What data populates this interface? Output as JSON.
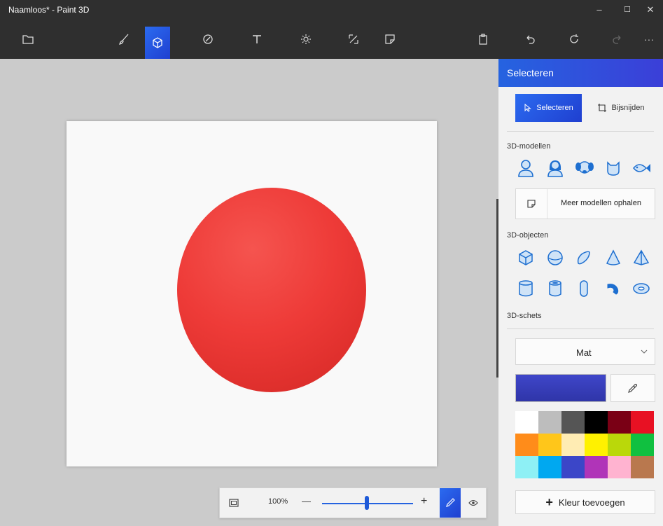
{
  "window": {
    "title": "Naamloos* - Paint 3D"
  },
  "window_controls": {
    "minimize": "–",
    "maximize": "☐",
    "close": "✕"
  },
  "toolbar": {
    "more_label": "···"
  },
  "zoom": {
    "value_text": "100%",
    "minus": "—",
    "plus": "+",
    "slider_level": 0.5
  },
  "panel": {
    "header": "Selecteren",
    "select_label": "Selecteren",
    "crop_label": "Bijsnijden",
    "section_models": "3D-modellen",
    "more_models_label": "Meer modellen ophalen",
    "section_objects": "3D-objecten",
    "section_sketch": "3D-schets",
    "material_dropdown": "Mat",
    "add_color_label": "Kleur toevoegen",
    "add_color_plus": "+",
    "current_color": "#3a3fbf"
  },
  "palette": [
    "#ffffff",
    "#bdbdbd",
    "#555555",
    "#000000",
    "#7a0015",
    "#e81123",
    "#ff8c1a",
    "#ffc61a",
    "#ffecb3",
    "#fff100",
    "#bad80a",
    "#10c040",
    "#8ef0f5",
    "#00a8f0",
    "#3b46c8",
    "#b034b8",
    "#ffb3d0",
    "#b9784e"
  ],
  "colors": {
    "accent": "#2563e0",
    "sphere": "#ee3b38",
    "dark": "#2f2f2f"
  }
}
